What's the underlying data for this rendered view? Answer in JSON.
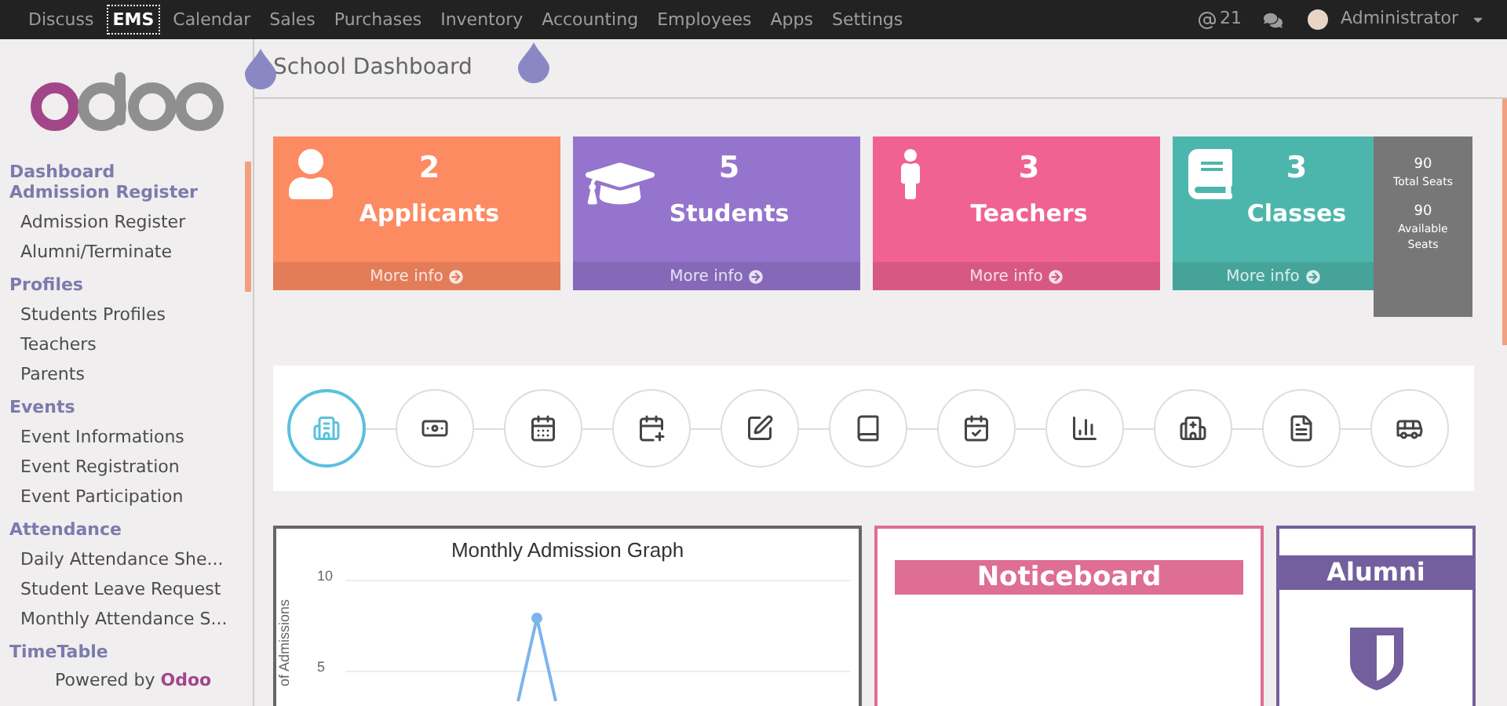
{
  "top_menu": [
    {
      "label": "Discuss",
      "selected": false
    },
    {
      "label": "EMS",
      "selected": true
    },
    {
      "label": "Calendar",
      "selected": false
    },
    {
      "label": "Sales",
      "selected": false
    },
    {
      "label": "Purchases",
      "selected": false
    },
    {
      "label": "Inventory",
      "selected": false
    },
    {
      "label": "Accounting",
      "selected": false
    },
    {
      "label": "Employees",
      "selected": false
    },
    {
      "label": "Apps",
      "selected": false
    },
    {
      "label": "Settings",
      "selected": false
    }
  ],
  "user_bar": {
    "mentions": "21",
    "user": "Administrator"
  },
  "sidebar": {
    "sections": [
      {
        "title": "Dashboard"
      },
      {
        "title": "Admission Register",
        "items": [
          "Admission Register",
          "Alumni/Terminate"
        ]
      },
      {
        "title": "Profiles",
        "items": [
          "Students Profiles",
          "Teachers",
          "Parents"
        ]
      },
      {
        "title": "Events",
        "items": [
          "Event Informations",
          "Event Registration",
          "Event Participation"
        ]
      },
      {
        "title": "Attendance",
        "items": [
          "Daily Attendance She...",
          "Student Leave Request",
          "Monthly Attendance S..."
        ]
      },
      {
        "title": "TimeTable"
      }
    ],
    "footer_prefix": "Powered by",
    "footer_brand": "Odoo"
  },
  "page_title": "School Dashboard",
  "stat_cards": [
    {
      "count": "2",
      "label": "Applicants",
      "link": "More info",
      "color": "#fd8b62"
    },
    {
      "count": "5",
      "label": "Students",
      "link": "More info",
      "color": "#9574cd"
    },
    {
      "count": "3",
      "label": "Teachers",
      "link": "More info",
      "color": "#f06292"
    },
    {
      "count": "3",
      "label": "Classes",
      "link": "More info",
      "color": "#4db6ac"
    }
  ],
  "seats": [
    {
      "value": "90",
      "label": "Total Seats"
    },
    {
      "value": "90",
      "label": "Available Seats"
    }
  ],
  "shortcuts": [
    {
      "selected": true
    },
    {
      "selected": false
    },
    {
      "selected": false
    },
    {
      "selected": false
    },
    {
      "selected": false
    },
    {
      "selected": false
    },
    {
      "selected": false
    },
    {
      "selected": false
    },
    {
      "selected": false
    },
    {
      "selected": false
    },
    {
      "selected": false
    }
  ],
  "admission_graph": {
    "title": "Monthly Admission Graph",
    "ylabel": "of Admissions",
    "ytick_labels": [
      "10",
      "5"
    ]
  },
  "noticeboard": {
    "title": "Noticeboard"
  },
  "alumni": {
    "title": "Alumni"
  }
}
